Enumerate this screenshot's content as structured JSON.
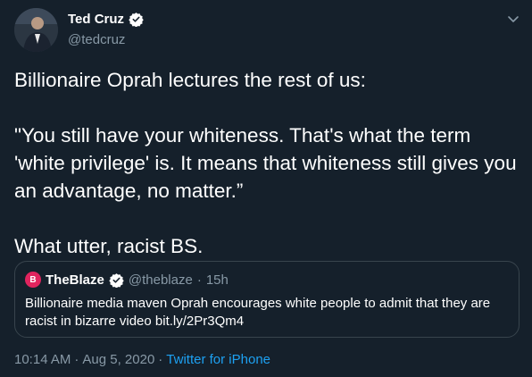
{
  "author": {
    "name": "Ted Cruz",
    "handle": "@tedcruz",
    "verified_icon": "verified-badge-icon"
  },
  "tweet": {
    "lines": [
      "Billionaire Oprah lectures the rest of us:",
      "\"You still have your whiteness. That's what the term 'white privilege' is. It means that whiteness still gives you an advantage, no matter.”",
      "What utter, racist BS."
    ]
  },
  "quote": {
    "logo_text": "B",
    "name": "TheBlaze",
    "handle": "@theblaze",
    "separator": "·",
    "time": "15h",
    "text": "Billionaire media maven Oprah encourages white people to admit that they are racist in bizarre video bit.ly/2Pr3Qm4"
  },
  "meta": {
    "time": "10:14 AM",
    "separator": "·",
    "date": "Aug 5, 2020",
    "separator2": "·",
    "source": "Twitter for iPhone"
  },
  "colors": {
    "background": "#15202b",
    "muted_text": "#8899a6",
    "link": "#1da1f2",
    "verified_badge": "#ffffff",
    "blaze_red": "#e0245e",
    "border": "#38444d"
  },
  "icons": [
    "avatar",
    "verified-badge-icon",
    "chevron-down-icon",
    "theblaze-logo-icon"
  ]
}
